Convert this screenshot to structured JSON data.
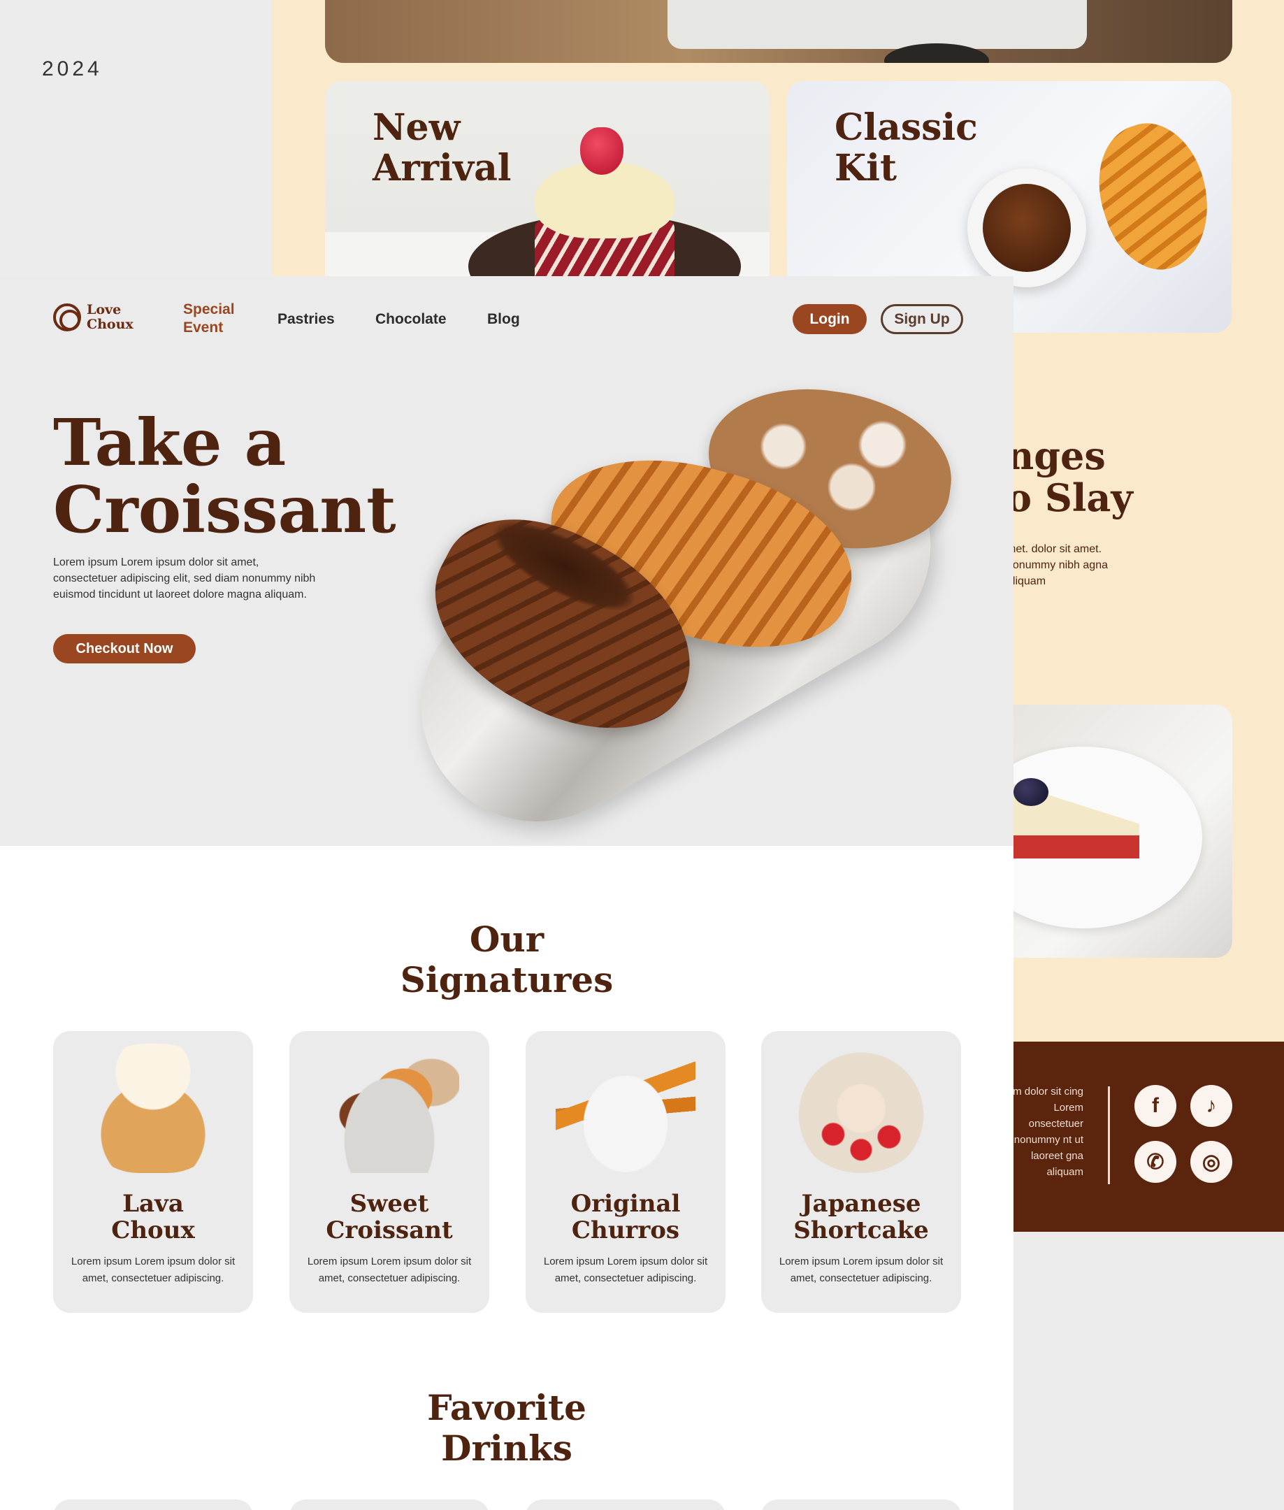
{
  "year_label": "2024",
  "back_page": {
    "cards": [
      {
        "title": "New\nArrival"
      },
      {
        "title": "Classic\nKit"
      }
    ],
    "section_heading": "nges\no Slay",
    "section_body": "met. dolor sit amet. nonummy nibh agna aliquam",
    "footer_text": "um dolor sit cing Lorem onsectetuer nonummy nt ut laoreet gna aliquam",
    "social_icons": [
      "facebook-icon",
      "tiktok-icon",
      "whatsapp-icon",
      "instagram-icon"
    ]
  },
  "front_page": {
    "logo_text": "Love\nChoux",
    "nav": {
      "special_event": "Special\nEvent",
      "pastries": "Pastries",
      "chocolate": "Chocolate",
      "blog": "Blog"
    },
    "auth": {
      "login": "Login",
      "signup": "Sign Up"
    },
    "hero": {
      "title": "Take a\nCroissant",
      "body": "Lorem ipsum Lorem ipsum dolor sit amet, consectetuer adipiscing elit, sed diam nonummy nibh euismod tincidunt ut laoreet dolore magna aliquam.",
      "cta": "Checkout Now"
    },
    "signatures": {
      "title": "Our\nSignatures",
      "items": [
        {
          "name": "Lava\nChoux",
          "desc": "Lorem ipsum Lorem ipsum dolor sit amet, consectetuer adipiscing."
        },
        {
          "name": "Sweet\nCroissant",
          "desc": "Lorem ipsum Lorem ipsum dolor sit amet, consectetuer adipiscing."
        },
        {
          "name": "Original\nChurros",
          "desc": "Lorem ipsum Lorem ipsum dolor sit amet, consectetuer adipiscing."
        },
        {
          "name": "Japanese\nShortcake",
          "desc": "Lorem ipsum Lorem ipsum dolor sit amet, consectetuer adipiscing."
        }
      ]
    },
    "drinks": {
      "title": "Favorite\nDrinks"
    }
  },
  "colors": {
    "brand_brown": "#4e2310",
    "accent_rust": "#9a4620",
    "cream": "#fbe9cb",
    "footer_brown": "#5a240d"
  }
}
